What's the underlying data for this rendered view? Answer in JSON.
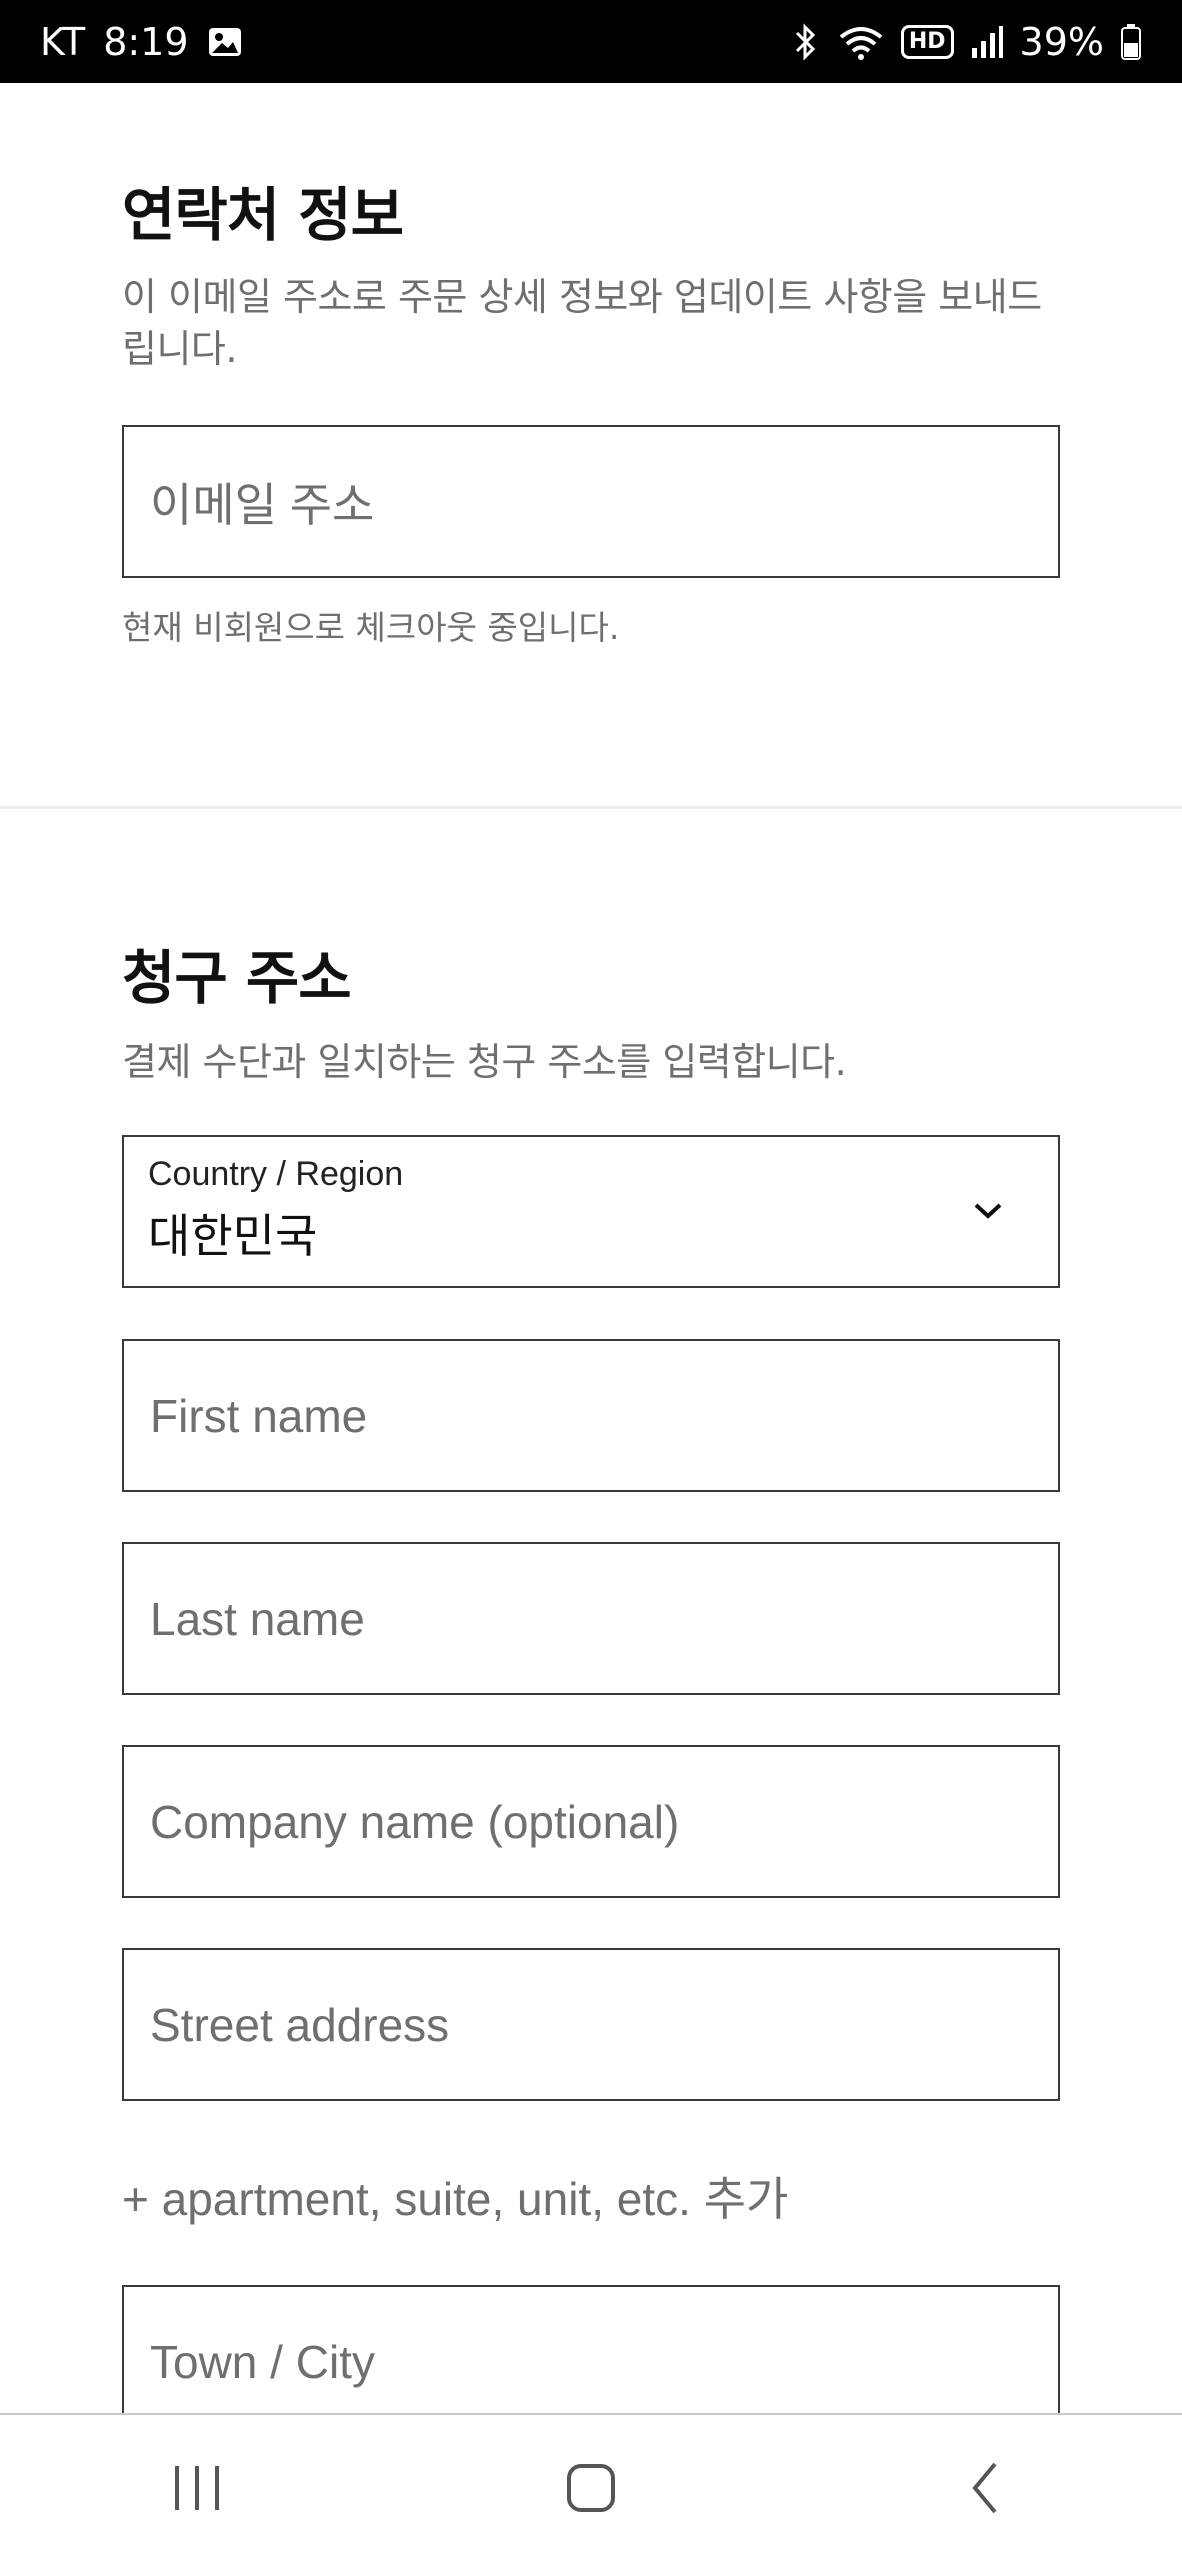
{
  "status_bar": {
    "carrier": "KT",
    "time": "8:19",
    "battery": "39%",
    "hd_label": "HD",
    "icons": [
      "image-icon",
      "bluetooth-icon",
      "wifi-icon",
      "signal-icon",
      "battery-icon"
    ]
  },
  "contact_section": {
    "title": "연락처 정보",
    "description": "이 이메일 주소로 주문 상세 정보와 업데이트 사항을 보내드립니다.",
    "email_placeholder": "이메일 주소",
    "guest_note": "현재 비회원으로 체크아웃 중입니다."
  },
  "billing_section": {
    "title": "청구 주소",
    "description": "결제 수단과 일치하는 청구 주소를 입력합니다.",
    "country_label": "Country / Region",
    "country_value": "대한민국",
    "first_name_placeholder": "First name",
    "last_name_placeholder": "Last name",
    "company_placeholder": "Company name (optional)",
    "street_placeholder": "Street address",
    "add_apartment_link": "+ apartment, suite, unit, etc. 추가",
    "town_placeholder": "Town / City"
  },
  "nav_bar": {
    "buttons": [
      "recent-apps",
      "home",
      "back"
    ]
  }
}
